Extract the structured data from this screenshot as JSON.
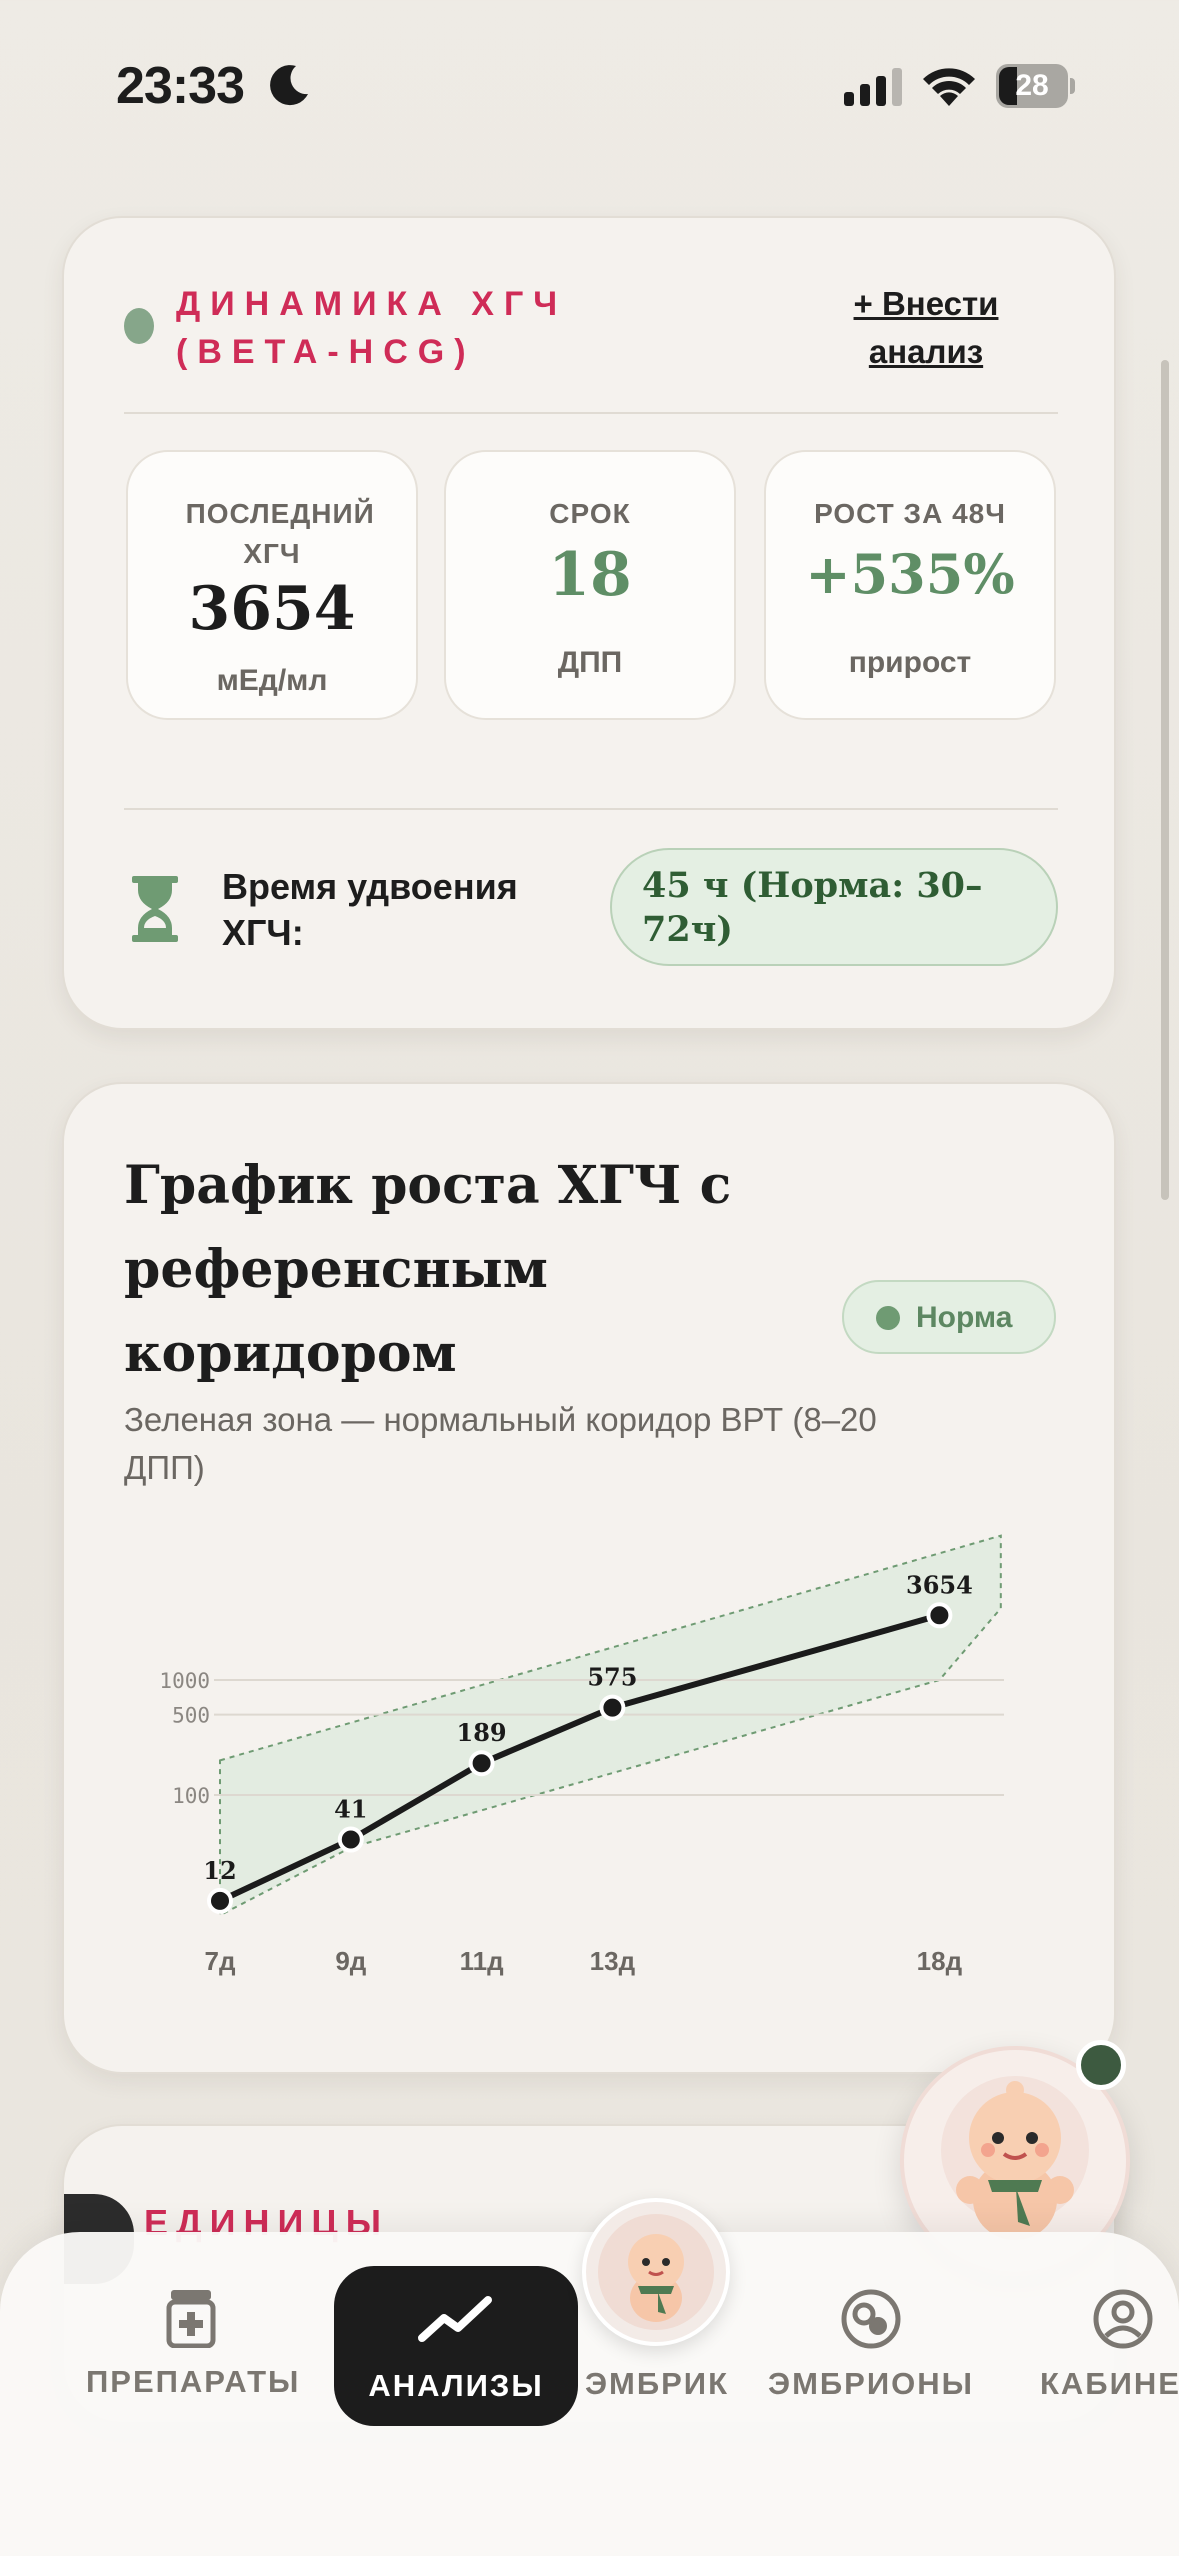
{
  "status_bar": {
    "time": "23:33",
    "battery": "28"
  },
  "hcg_card": {
    "title": "ДИНАМИКА ХГЧ (BETA-HCG)",
    "add_link": "+ Внести анализ",
    "stats": [
      {
        "label": "ПОСЛЕДНИЙ ХГЧ",
        "value": "3654",
        "sub": "мЕд/мл"
      },
      {
        "label": "СРОК",
        "value": "18",
        "sub": "ДПП"
      },
      {
        "label": "РОСТ ЗА 48Ч",
        "value": "+535%",
        "sub": "прирост"
      }
    ],
    "doubling_label": "Время удвоения ХГЧ:",
    "doubling_value": "45 ч (Норма: 30–72ч)"
  },
  "chart_card": {
    "title": "График роста ХГЧ с референсным коридором",
    "badge": "Норма",
    "subtitle": "Зеленая зона — нормальный коридор ВРТ (8–20 ДПП)"
  },
  "chart_data": {
    "type": "line",
    "scale": "log",
    "x": [
      "7д",
      "9д",
      "11д",
      "13д",
      "18д"
    ],
    "x_days": [
      7,
      9,
      11,
      13,
      18
    ],
    "values": [
      12,
      41,
      189,
      575,
      3654
    ],
    "y_ticks": [
      100,
      500,
      1000
    ],
    "y_tick_labels": [
      "100",
      "500",
      "1000"
    ],
    "reference_band": {
      "x_range": [
        7,
        19
      ],
      "lower": [
        10,
        100,
        300,
        1000,
        1000
      ],
      "upper": [
        200,
        500,
        1000,
        5000,
        5000
      ]
    },
    "colors": {
      "line": "#1b1b1b",
      "band_fill": "#e3ece1",
      "band_stroke": "#6f9b73"
    }
  },
  "bottom_card": {
    "title": "ЕДИНИЦЫ"
  },
  "tabbar": {
    "tabs": [
      {
        "label": "ПРЕПАРАТЫ",
        "icon": "pill-bottle-icon"
      },
      {
        "label": "АНАЛИЗЫ",
        "icon": "trend-chart-icon",
        "active": true
      },
      {
        "label": "ЭМБРИК",
        "icon": "baby-mascot-icon"
      },
      {
        "label": "ЭМБРИОНЫ",
        "icon": "embryo-icon"
      },
      {
        "label": "КАБИНЕТ",
        "icon": "user-icon"
      }
    ]
  }
}
